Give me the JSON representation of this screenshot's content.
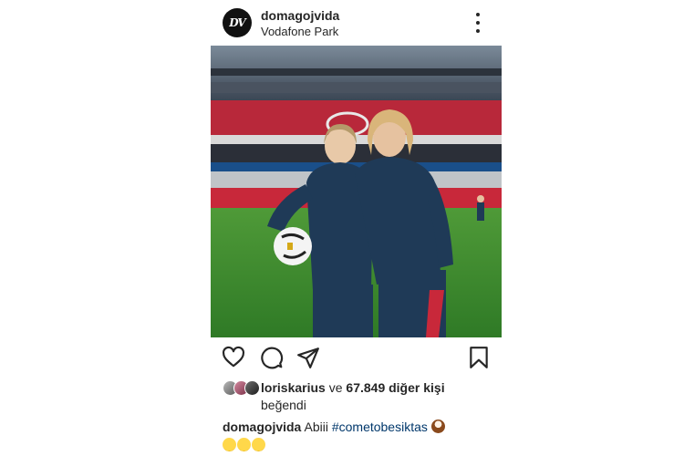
{
  "post": {
    "username": "domagojvida",
    "location": "Vodafone Park",
    "avatar_monogram": "DV",
    "more_icon": "more-vertical-icon"
  },
  "actions": {
    "like_icon": "heart-icon",
    "comment_icon": "comment-icon",
    "share_icon": "send-icon",
    "save_icon": "bookmark-icon"
  },
  "likes": {
    "first_user": "loriskarius",
    "connector": " ve ",
    "count_text": "67.849 diğer kişi",
    "line2": "beğendi"
  },
  "caption": {
    "author": "domagojvida",
    "text": " Abiii ",
    "hashtag": "#cometobesiktas"
  },
  "colors": {
    "text": "#262626",
    "hashtag": "#00376b",
    "pitch": "#3e8f2f",
    "stands": "#b8283a",
    "kit": "#1f3a57"
  }
}
